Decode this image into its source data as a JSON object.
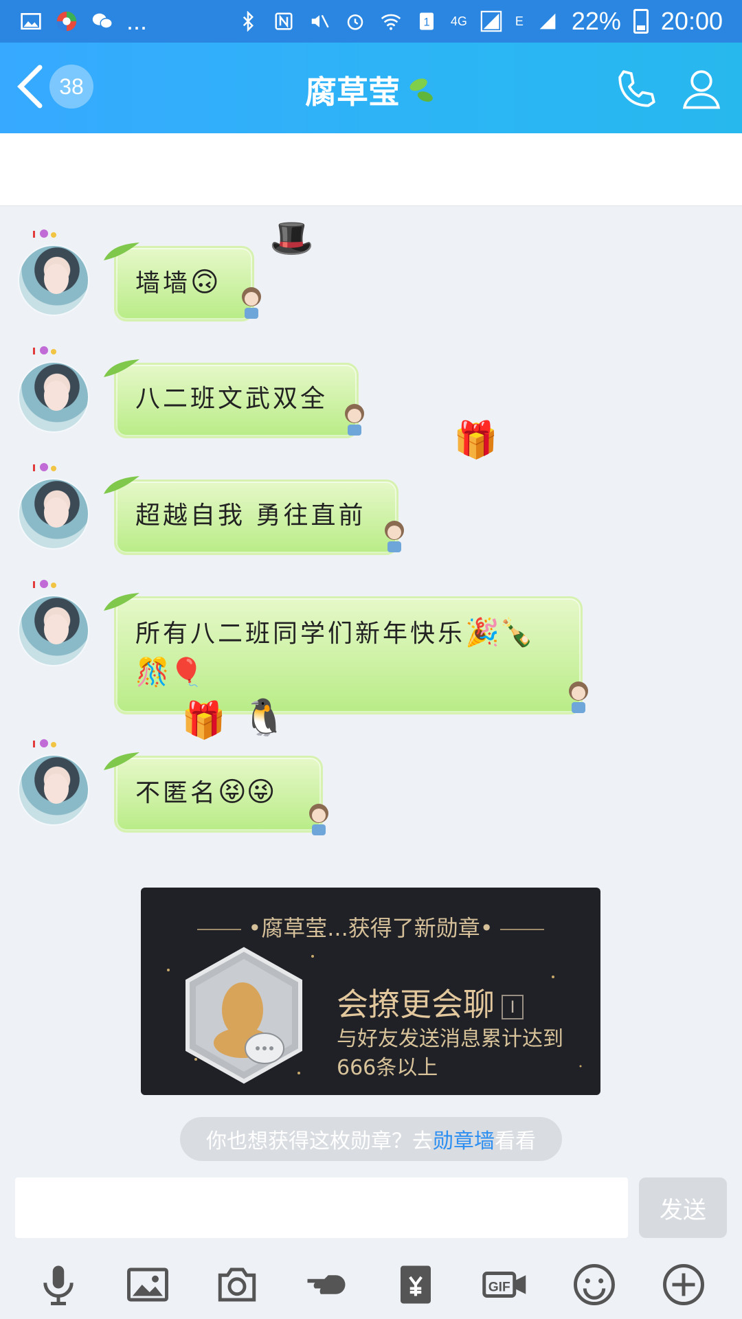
{
  "status_bar": {
    "battery": "22%",
    "time": "20:00",
    "network": "4G",
    "network2": "E",
    "ellipsis": "..."
  },
  "header": {
    "unread_count": "38",
    "title": "腐草莹"
  },
  "messages": [
    {
      "text": "墙墙",
      "emoji": "🙃"
    },
    {
      "text": "八二班文武双全",
      "emoji": ""
    },
    {
      "text": "超越自我 勇往直前",
      "emoji": ""
    },
    {
      "text": "所有八二班同学们新年快乐",
      "emoji": "🎉🍾",
      "line2_emoji": "🎊🎈"
    },
    {
      "text": "不匿名",
      "emoji": "😝😜"
    }
  ],
  "badge": {
    "title": "腐草莹...获得了新勋章",
    "name": "会撩更会聊",
    "info": "I",
    "desc": "与好友发送消息累计达到666条以上"
  },
  "hint": {
    "prefix": "你也想获得这枚勋章？去",
    "link": "勋章墙",
    "suffix": "看看"
  },
  "input": {
    "placeholder": "",
    "send_label": "发送"
  },
  "colors": {
    "header": "#2cb5f5",
    "bubble": "#b9ec87",
    "badge_bg": "#1f2126",
    "link": "#2b8ef0"
  },
  "toolbar_icons": [
    "mic-icon",
    "image-icon",
    "camera-icon",
    "poke-icon",
    "red-packet-icon",
    "gif-icon",
    "emoji-icon",
    "plus-icon"
  ]
}
